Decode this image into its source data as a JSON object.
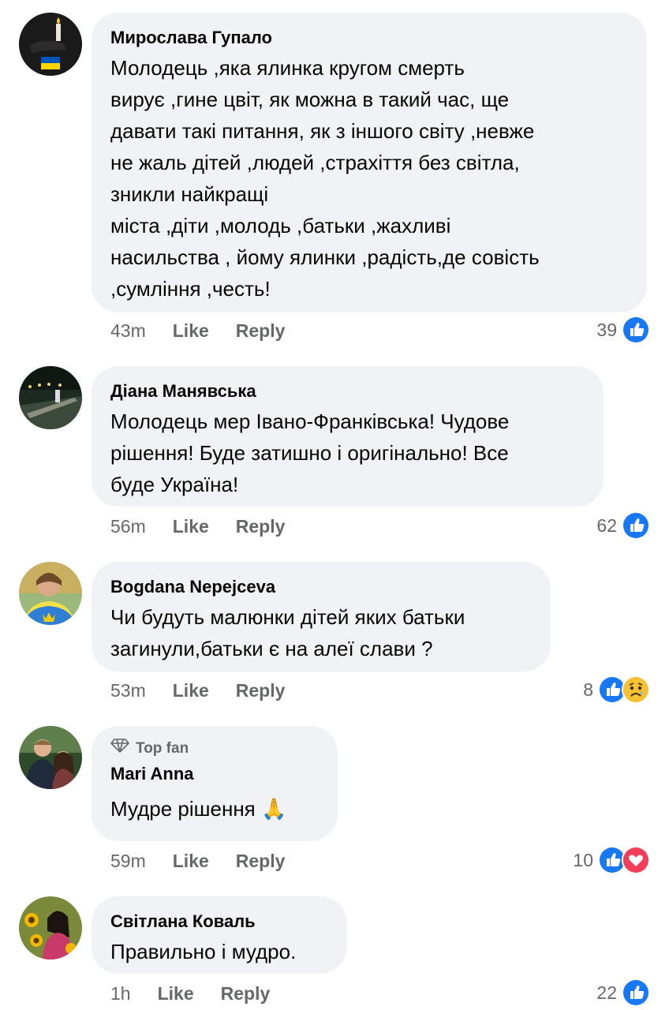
{
  "comments": [
    {
      "author": "Мирослава Гупало",
      "text": "Молодець ,яка ялинка кругом смерть\nвирує ,гине цвіт, як можна в такий час, ще\nдавати такі питання, як з іншого світу ,невже\nне жаль дітей ,людей ,страхіття без світла,\nзникли найкращі\nміста ,діти ,молодь ,батьки ,жахливі\nнасильства  , йому ялинки  ,радість,де совість\n,сумління ,честь!",
      "time": "43m",
      "like_label": "Like",
      "reply_label": "Reply",
      "reaction_count": "39",
      "reactions": [
        "like-icon"
      ]
    },
    {
      "author": "Діана Манявська",
      "text": "Молодець мер Івано-Франківська! Чудове\nрішення! Буде затишно і оригінально! Все\nбуде Україна!",
      "time": "56m",
      "like_label": "Like",
      "reply_label": "Reply",
      "reaction_count": "62",
      "reactions": [
        "like-icon"
      ]
    },
    {
      "author": "Bogdana Nepejceva",
      "text": "Чи будуть малюнки дітей яких батьки\nзагинули,батьки є на алеї слави ?",
      "time": "53m",
      "like_label": "Like",
      "reply_label": "Reply",
      "reaction_count": "8",
      "reactions": [
        "like-icon",
        "sad-icon"
      ]
    },
    {
      "badge": "Top fan",
      "author": "Mari Anna",
      "text": "Мудре рішення 🙏",
      "time": "59m",
      "like_label": "Like",
      "reply_label": "Reply",
      "reaction_count": "10",
      "reactions": [
        "like-icon",
        "love-icon"
      ]
    },
    {
      "author": "Світлана Коваль",
      "text": "Правильно і мудро.",
      "time": "1h",
      "like_label": "Like",
      "reply_label": "Reply",
      "reaction_count": "22",
      "reactions": [
        "like-icon"
      ]
    }
  ],
  "colors": {
    "bubble": "#f0f2f5",
    "meta_text": "#65676b",
    "like_blue": "#1877f2",
    "love_red": "#f33e58"
  }
}
